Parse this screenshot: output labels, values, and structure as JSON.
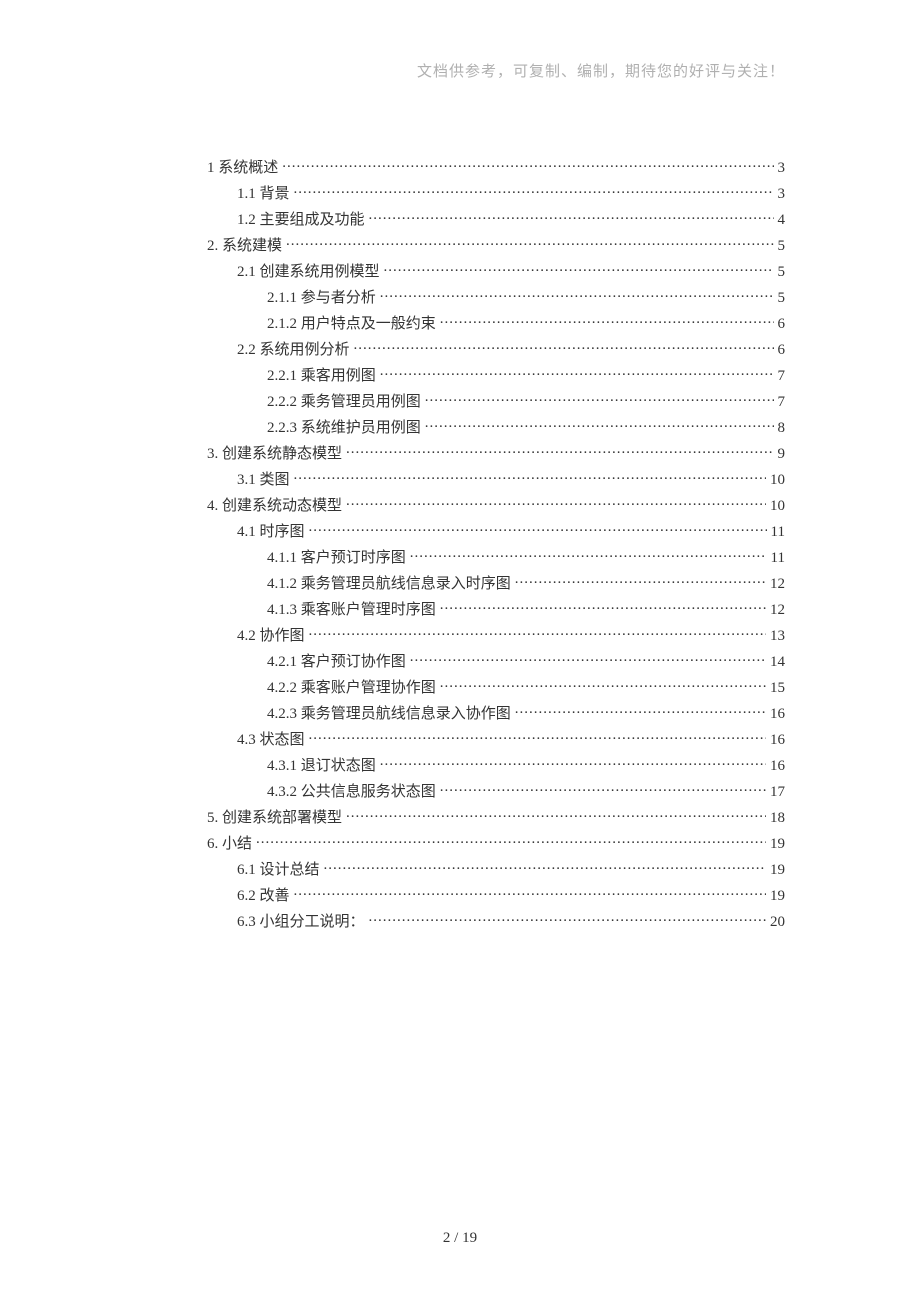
{
  "header_note": "文档供参考，可复制、编制，期待您的好评与关注！",
  "page_number": "2 / 19",
  "toc": [
    {
      "level": 1,
      "title": "1  系统概述",
      "page": "3"
    },
    {
      "level": 2,
      "title": "1.1 背景",
      "page": "3"
    },
    {
      "level": 2,
      "title": "1.2 主要组成及功能",
      "page": "4"
    },
    {
      "level": 1,
      "title": "2.  系统建模",
      "page": "5"
    },
    {
      "level": 2,
      "title": "2.1 创建系统用例模型",
      "page": "5"
    },
    {
      "level": 3,
      "title": "2.1.1 参与者分析",
      "page": "5"
    },
    {
      "level": 3,
      "title": "2.1.2 用户特点及一般约束",
      "page": "6"
    },
    {
      "level": 2,
      "title": "2.2  系统用例分析",
      "page": "6"
    },
    {
      "level": 3,
      "title": "2.2.1 乘客用例图",
      "page": "7"
    },
    {
      "level": 3,
      "title": "2.2.2 乘务管理员用例图",
      "page": "7"
    },
    {
      "level": 3,
      "title": "2.2.3 系统维护员用例图",
      "page": "8"
    },
    {
      "level": 1,
      "title": "3.  创建系统静态模型",
      "page": "9"
    },
    {
      "level": 2,
      "title": "3.1 类图",
      "page": "10"
    },
    {
      "level": 1,
      "title": "4.  创建系统动态模型",
      "page": "10"
    },
    {
      "level": 2,
      "title": "4.1 时序图",
      "page": "11"
    },
    {
      "level": 3,
      "title": "4.1.1 客户预订时序图",
      "page": "11"
    },
    {
      "level": 3,
      "title": "4.1.2 乘务管理员航线信息录入时序图",
      "page": "12"
    },
    {
      "level": 3,
      "title": "4.1.3 乘客账户管理时序图",
      "page": "12"
    },
    {
      "level": 2,
      "title": "4.2 协作图",
      "page": "13"
    },
    {
      "level": 3,
      "title": "4.2.1 客户预订协作图",
      "page": "14"
    },
    {
      "level": 3,
      "title": "4.2.2 乘客账户管理协作图",
      "page": "15"
    },
    {
      "level": 3,
      "title": "4.2.3 乘务管理员航线信息录入协作图",
      "page": "16"
    },
    {
      "level": 2,
      "title": "4.3 状态图",
      "page": "16"
    },
    {
      "level": 3,
      "title": "4.3.1 退订状态图",
      "page": "16"
    },
    {
      "level": 3,
      "title": "4.3.2 公共信息服务状态图",
      "page": "17"
    },
    {
      "level": 1,
      "title": "5.  创建系统部署模型",
      "page": "18"
    },
    {
      "level": 1,
      "title": "6.  小结",
      "page": "19"
    },
    {
      "level": 2,
      "title": "6.1 设计总结",
      "page": "19"
    },
    {
      "level": 2,
      "title": "6.2 改善",
      "page": "19"
    },
    {
      "level": 2,
      "title": "6.3 小组分工说明：",
      "page": "20"
    }
  ]
}
